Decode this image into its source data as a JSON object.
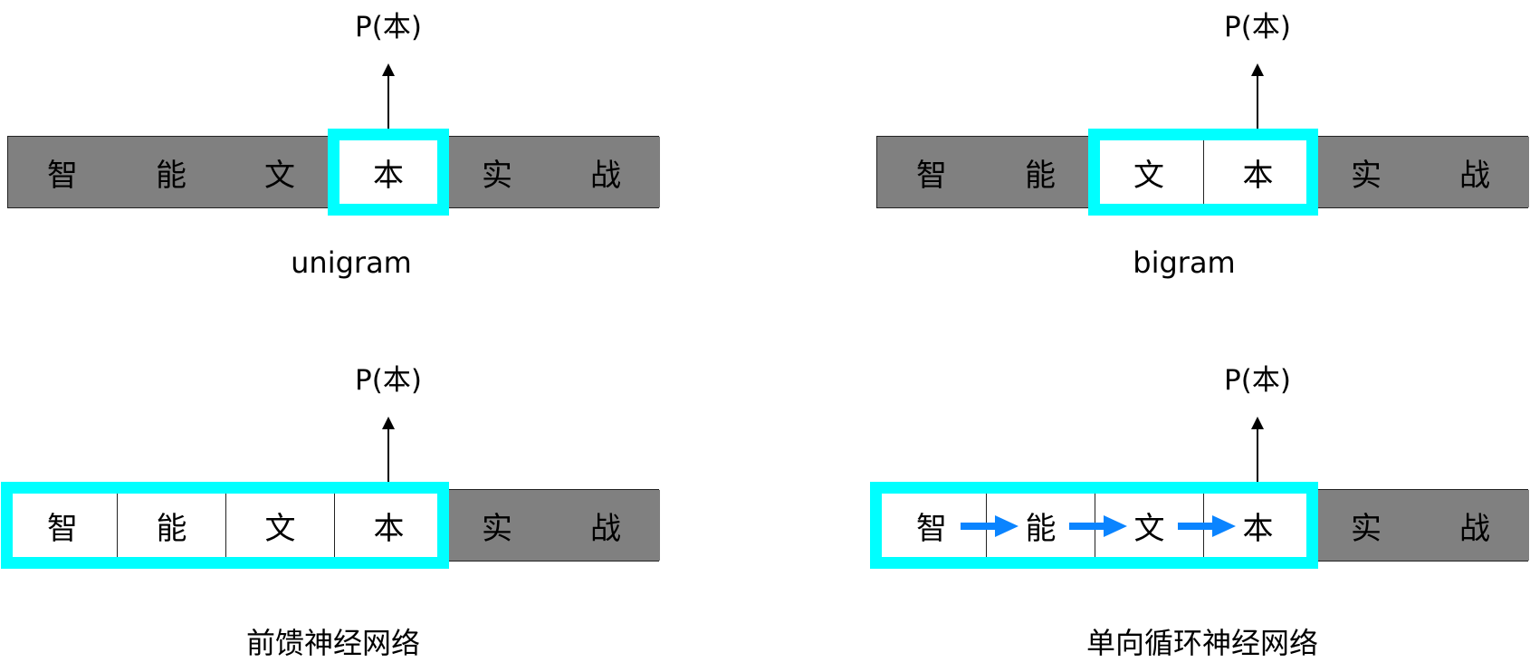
{
  "output_label": "P(本)",
  "tokens": [
    "智",
    "能",
    "文",
    "本",
    "实",
    "战"
  ],
  "colors": {
    "context_highlight": "#00ffff",
    "token_background": "#808080",
    "recurrent_arrow": "#0a84ff"
  },
  "panels": [
    {
      "id": "unigram",
      "caption": "unigram",
      "context": [
        3,
        3
      ],
      "recurrent": false
    },
    {
      "id": "bigram",
      "caption": "bigram",
      "context": [
        2,
        3
      ],
      "recurrent": false
    },
    {
      "id": "ffnn",
      "caption": "前馈神经网络",
      "context": [
        0,
        3
      ],
      "recurrent": false
    },
    {
      "id": "rnn",
      "caption": "单向循环神经网络",
      "context": [
        0,
        3
      ],
      "recurrent": true
    }
  ]
}
